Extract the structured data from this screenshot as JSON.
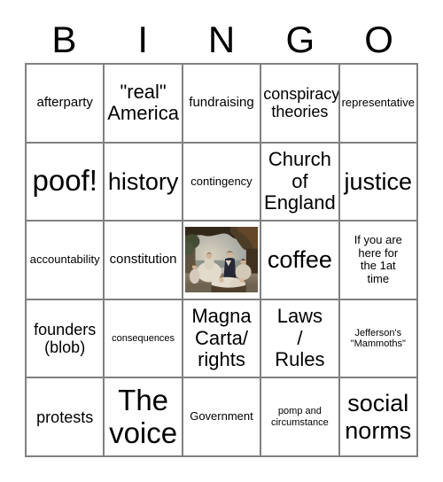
{
  "card": {
    "header_letters": [
      "B",
      "I",
      "N",
      "G",
      "O"
    ],
    "rows": [
      [
        {
          "text": "afterparty",
          "size": "md",
          "type": "text"
        },
        {
          "text": "\"real\"\nAmerica",
          "size": "xl",
          "type": "text"
        },
        {
          "text": "fundraising",
          "size": "md",
          "type": "text"
        },
        {
          "text": "conspiracy\ntheories",
          "size": "lg",
          "type": "text"
        },
        {
          "text": "representative",
          "size": "sm",
          "type": "text"
        }
      ],
      [
        {
          "text": "poof!",
          "size": "huge",
          "type": "text"
        },
        {
          "text": "history",
          "size": "xxl",
          "type": "text"
        },
        {
          "text": "contingency",
          "size": "sm",
          "type": "text"
        },
        {
          "text": "Church\nof\nEngland",
          "size": "xl",
          "type": "text"
        },
        {
          "text": "justice",
          "size": "xxl",
          "type": "text"
        }
      ],
      [
        {
          "text": "accountability",
          "size": "sm",
          "type": "text"
        },
        {
          "text": "constitution",
          "size": "md",
          "type": "text"
        },
        {
          "text": "",
          "size": "md",
          "type": "image",
          "image_name": "victorian-royal-family-painting"
        },
        {
          "text": "coffee",
          "size": "xxl",
          "type": "text"
        },
        {
          "text": "If you are\nhere for\nthe 1at\ntime",
          "size": "sm",
          "type": "text"
        }
      ],
      [
        {
          "text": "founders\n(blob)",
          "size": "lg",
          "type": "text"
        },
        {
          "text": "consequences",
          "size": "xs",
          "type": "text"
        },
        {
          "text": "Magna\nCarta/\nrights",
          "size": "xl",
          "type": "text"
        },
        {
          "text": "Laws\n/\nRules",
          "size": "xl",
          "type": "text"
        },
        {
          "text": "Jefferson's\n\"Mammoths\"",
          "size": "xs",
          "type": "text"
        }
      ],
      [
        {
          "text": "protests",
          "size": "lg",
          "type": "text"
        },
        {
          "text": "The\nvoice",
          "size": "huge",
          "type": "text"
        },
        {
          "text": "Government",
          "size": "sm",
          "type": "text"
        },
        {
          "text": "pomp and\ncircumstance",
          "size": "xs",
          "type": "text"
        },
        {
          "text": "social\nnorms",
          "size": "xxl",
          "type": "text"
        }
      ]
    ]
  },
  "colors": {
    "grid_line": "#808080",
    "text": "#000000",
    "background": "#ffffff"
  }
}
